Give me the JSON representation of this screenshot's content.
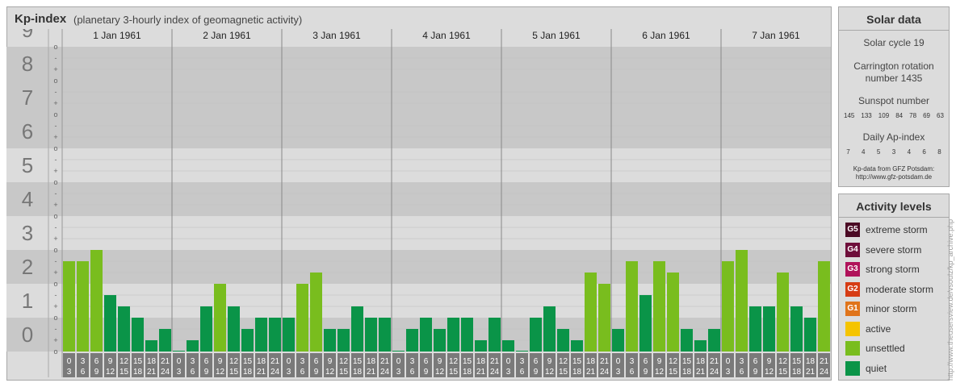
{
  "header": {
    "title": "Kp-index",
    "subtitle": "(planetary 3-hourly index of geomagnetic activity)"
  },
  "chart_data": {
    "type": "bar",
    "title": "Kp-index",
    "subtitle": "(planetary 3-hourly index of geomagnetic activity)",
    "ylim": [
      0,
      9
    ],
    "y_ticks": [
      "0",
      "1",
      "2",
      "3",
      "4",
      "5",
      "6",
      "7",
      "8",
      "9"
    ],
    "minor_tick_marks": [
      "o",
      "+",
      "-"
    ],
    "days": [
      "1 Jan 1961",
      "2 Jan 1961",
      "3 Jan 1961",
      "4 Jan 1961",
      "5 Jan 1961",
      "6 Jan 1961",
      "7 Jan 1961"
    ],
    "interval_start": [
      "0",
      "3",
      "6",
      "9",
      "12",
      "15",
      "18",
      "21"
    ],
    "interval_end": [
      "3",
      "6",
      "9",
      "12",
      "15",
      "18",
      "21",
      "24"
    ],
    "values": [
      2.667,
      2.667,
      3.0,
      1.667,
      1.333,
      1.0,
      0.333,
      0.667,
      0.0,
      0.333,
      1.333,
      2.0,
      1.333,
      0.667,
      1.0,
      1.0,
      1.0,
      2.0,
      2.333,
      0.667,
      0.667,
      1.333,
      1.0,
      1.0,
      0.0,
      0.667,
      1.0,
      0.667,
      1.0,
      1.0,
      0.333,
      1.0,
      0.333,
      0.0,
      1.0,
      1.333,
      0.667,
      0.333,
      2.333,
      2.0,
      0.667,
      2.667,
      1.667,
      2.667,
      2.333,
      0.667,
      0.333,
      0.667,
      2.667,
      3.0,
      1.333,
      1.333,
      2.333,
      1.333,
      1.0,
      2.667
    ],
    "colors": {
      "quiet": "#0a9448",
      "unsettled": "#79bd1e"
    },
    "grid": true
  },
  "solar": {
    "title": "Solar data",
    "cycle": "Solar cycle 19",
    "carrington_line1": "Carrington rotation",
    "carrington_line2": "number 1435",
    "sunspot_label": "Sunspot number",
    "sunspot_values": [
      "145",
      "133",
      "109",
      "84",
      "78",
      "69",
      "63"
    ],
    "ap_label": "Daily Ap-index",
    "ap_values": [
      "7",
      "4",
      "5",
      "3",
      "4",
      "6",
      "8"
    ],
    "credit_line1": "Kp-data from GFZ Potsdam:",
    "credit_line2": "http://www.gfz-potsdam.de"
  },
  "activity": {
    "title": "Activity levels",
    "items": [
      {
        "badge": "G5",
        "label": "extreme storm",
        "color": "#4b0a24"
      },
      {
        "badge": "G4",
        "label": "severe storm",
        "color": "#6e0e3a"
      },
      {
        "badge": "G3",
        "label": "strong storm",
        "color": "#b0125a"
      },
      {
        "badge": "G2",
        "label": "moderate storm",
        "color": "#d63c14"
      },
      {
        "badge": "G1",
        "label": "minor storm",
        "color": "#e0741a"
      },
      {
        "badge": "",
        "label": "active",
        "color": "#f5c400"
      },
      {
        "badge": "",
        "label": "unsettled",
        "color": "#79bd1e"
      },
      {
        "badge": "",
        "label": "quiet",
        "color": "#0a9448"
      }
    ]
  },
  "watermark": "http://www.theusersview.de/vsoulz/kp_archive.php"
}
